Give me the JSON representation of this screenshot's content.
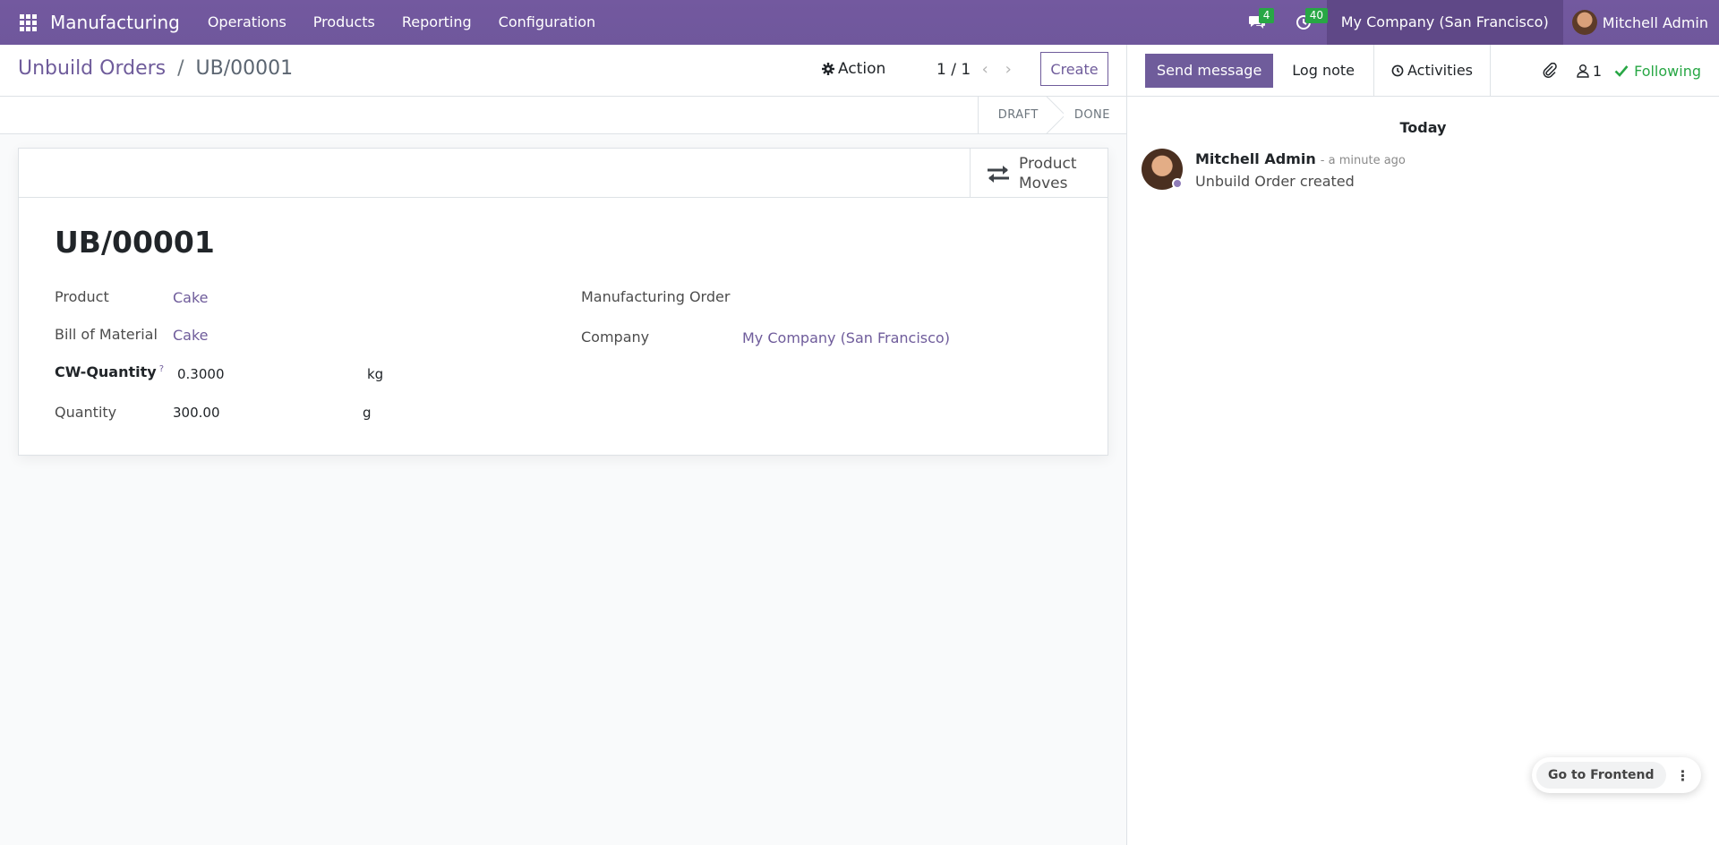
{
  "navbar": {
    "app_name": "Manufacturing",
    "menu": [
      "Operations",
      "Products",
      "Reporting",
      "Configuration"
    ],
    "messages_count": "4",
    "activities_count": "40",
    "company": "My Company (San Francisco)",
    "user": "Mitchell Admin"
  },
  "control_panel": {
    "breadcrumb_parent": "Unbuild Orders",
    "breadcrumb_sep": "/",
    "breadcrumb_current": "UB/00001",
    "action_label": "Action",
    "pager": "1 / 1",
    "create_label": "Create"
  },
  "statusbar": {
    "steps": [
      "DRAFT",
      "DONE"
    ]
  },
  "form": {
    "smart_button": "Product Moves",
    "title": "UB/00001",
    "product_label": "Product",
    "product_value": "Cake",
    "bom_label": "Bill of Material",
    "bom_value": "Cake",
    "cw_quantity_label": "CW-Quantity",
    "cw_quantity_help": "?",
    "cw_quantity_value": "0.3000",
    "cw_quantity_uom": "kg",
    "quantity_label": "Quantity",
    "quantity_value": "300.00",
    "quantity_uom": "g",
    "mo_label": "Manufacturing Order",
    "company_label": "Company",
    "company_value": "My Company (San Francisco)"
  },
  "chatter": {
    "send_message": "Send message",
    "log_note": "Log note",
    "activities": "Activities",
    "followers_count": "1",
    "following": "Following",
    "today": "Today",
    "message": {
      "author": "Mitchell Admin",
      "date": "- a minute ago",
      "body": "Unbuild Order created"
    }
  },
  "frontend": {
    "label": "Go to Frontend",
    "more": "⋮"
  },
  "colors": {
    "navbar": "#6f579c",
    "accent": "#6f5c9b",
    "following": "#28a745",
    "badge": "#28a745"
  }
}
